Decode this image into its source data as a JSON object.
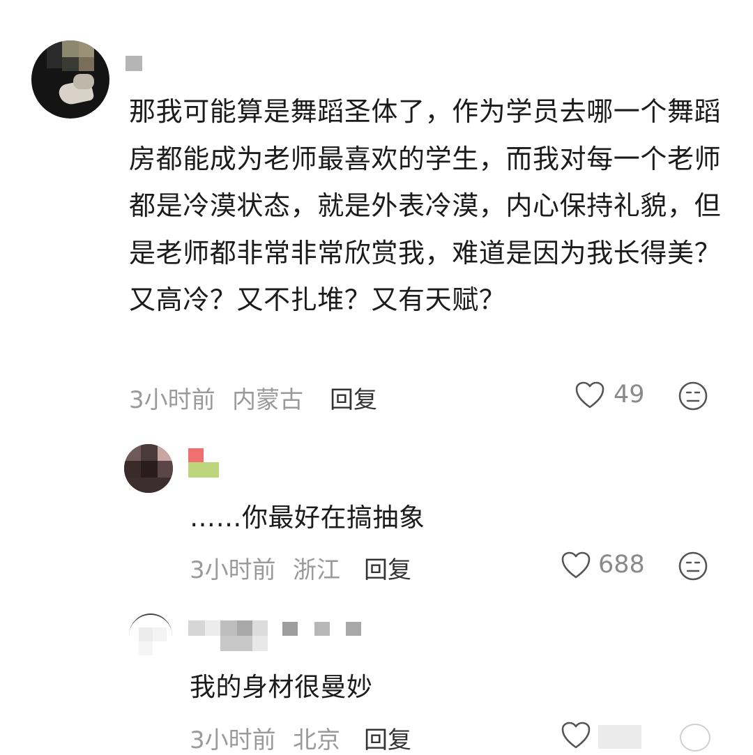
{
  "comment_main": {
    "text": "那我可能算是舞蹈圣体了，作为学员去哪一个舞蹈房都能成为老师最喜欢的学生，而我对每一个老师都是冷漠状态，就是外表冷漠，内心保持礼貌，但是老师都非常非常欣赏我，难道是因为我长得美？又高冷？又不扎堆？又有天赋？",
    "time": "3小时前",
    "location": "内蒙古",
    "reply_label": "回复",
    "likes": "49"
  },
  "reply_1": {
    "text": "……你最好在搞抽象",
    "time": "3小时前",
    "location": "浙江",
    "reply_label": "回复",
    "likes": "688"
  },
  "reply_2": {
    "text": "我的身材很曼妙",
    "time": "3小时前",
    "location": "北京",
    "reply_label": "回复",
    "likes": ""
  },
  "icons": {
    "like": "heart-outline-icon",
    "dislike": "meh-face-icon"
  },
  "colors": {
    "text": "#1b1b1b",
    "meta": "#9a9a9a",
    "icon": "#555555"
  }
}
